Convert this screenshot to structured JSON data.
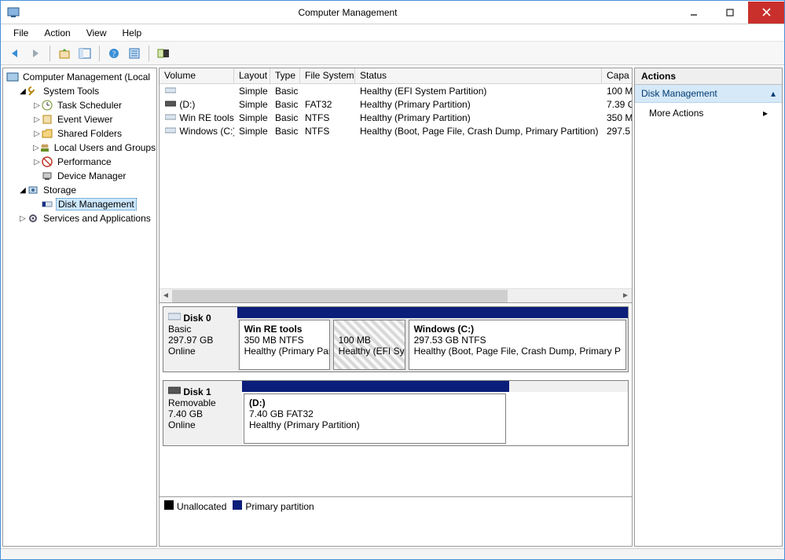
{
  "window": {
    "title": "Computer Management"
  },
  "menus": {
    "file": "File",
    "action": "Action",
    "view": "View",
    "help": "Help"
  },
  "tree": {
    "root": "Computer Management (Local",
    "systools": "System Tools",
    "task": "Task Scheduler",
    "event": "Event Viewer",
    "shared": "Shared Folders",
    "users": "Local Users and Groups",
    "perf": "Performance",
    "devmgr": "Device Manager",
    "storage": "Storage",
    "diskmgmt": "Disk Management",
    "services": "Services and Applications"
  },
  "columns": {
    "volume": "Volume",
    "layout": "Layout",
    "type": "Type",
    "fs": "File System",
    "status": "Status",
    "capa": "Capa"
  },
  "rows": [
    {
      "vol": "",
      "layout": "Simple",
      "type": "Basic",
      "fs": "",
      "status": "Healthy (EFI System Partition)",
      "cap": "100 M",
      "icon": "drive"
    },
    {
      "vol": "(D:)",
      "layout": "Simple",
      "type": "Basic",
      "fs": "FAT32",
      "status": "Healthy (Primary Partition)",
      "cap": "7.39 G",
      "icon": "removable"
    },
    {
      "vol": "Win RE tools",
      "layout": "Simple",
      "type": "Basic",
      "fs": "NTFS",
      "status": "Healthy (Primary Partition)",
      "cap": "350 M",
      "icon": "drive"
    },
    {
      "vol": "Windows (C:)",
      "layout": "Simple",
      "type": "Basic",
      "fs": "NTFS",
      "status": "Healthy (Boot, Page File, Crash Dump, Primary Partition)",
      "cap": "297.5",
      "icon": "drive"
    }
  ],
  "disk0": {
    "title": "Disk 0",
    "type": "Basic",
    "size": "297.97 GB",
    "state": "Online",
    "p1": {
      "name": "Win RE tools",
      "line2": "350 MB NTFS",
      "line3": "Healthy (Primary Par"
    },
    "p2": {
      "line2": "100 MB",
      "line3": "Healthy (EFI Sys"
    },
    "p3": {
      "name": "Windows  (C:)",
      "line2": "297.53 GB NTFS",
      "line3": "Healthy (Boot, Page File, Crash Dump, Primary P"
    }
  },
  "disk1": {
    "title": "Disk 1",
    "type": "Removable",
    "size": "7.40 GB",
    "state": "Online",
    "p1": {
      "name": " (D:)",
      "line2": "7.40 GB FAT32",
      "line3": "Healthy (Primary Partition)"
    }
  },
  "legend": {
    "unalloc": "Unallocated",
    "primary": "Primary partition"
  },
  "actions": {
    "header": "Actions",
    "section": "Disk Management",
    "more": "More Actions"
  }
}
